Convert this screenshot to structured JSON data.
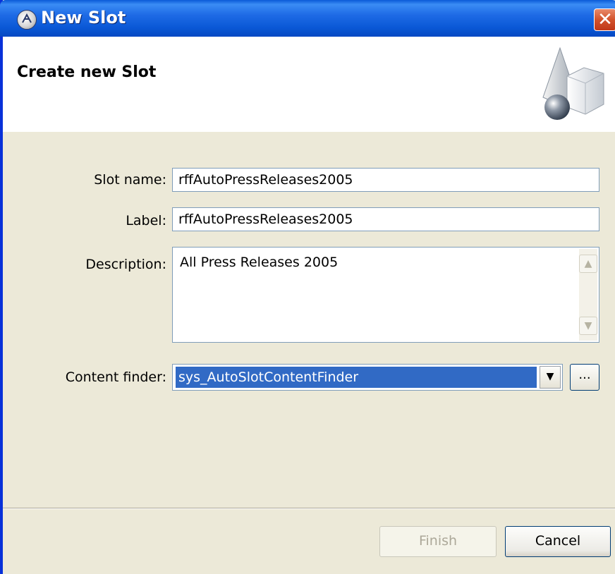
{
  "window": {
    "title": "New Slot",
    "close_glyph": "✕"
  },
  "banner": {
    "title": "Create new Slot",
    "art_icon": "shapes-icon"
  },
  "form": {
    "slot_name": {
      "label": "Slot name:",
      "value": "rffAutoPressReleases2005"
    },
    "label": {
      "label": "Label:",
      "value": "rffAutoPressReleases2005"
    },
    "description": {
      "label": "Description:",
      "value": "All Press Releases 2005"
    },
    "content_finder": {
      "label": "Content finder:",
      "value": "sys_AutoSlotContentFinder",
      "browse_label": "..."
    }
  },
  "buttons": {
    "finish": "Finish",
    "cancel": "Cancel"
  },
  "colors": {
    "title_bar": "#0a58d6",
    "selection": "#316ac5",
    "dialog_bg": "#ece9d8"
  }
}
